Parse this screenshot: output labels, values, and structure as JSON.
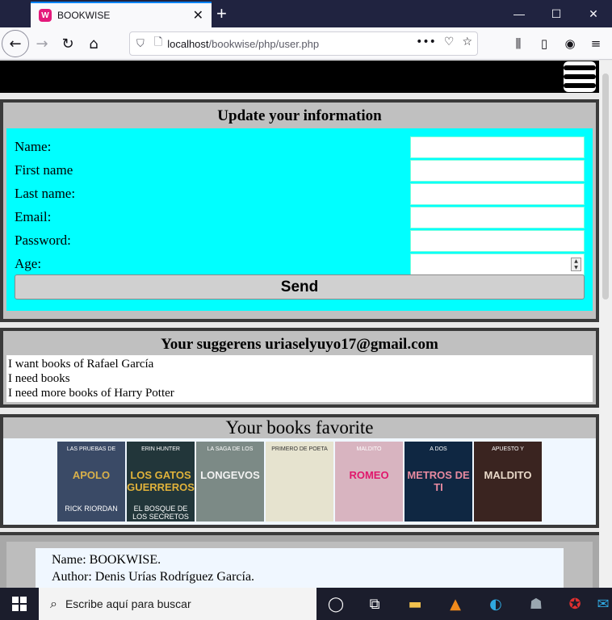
{
  "browser": {
    "tab_title": "BOOKWISE",
    "tab_favicon": "W",
    "url_host": "localhost",
    "url_path": "/bookwise/php/user.php"
  },
  "update_form": {
    "title": "Update your information",
    "fields": [
      {
        "label": "Name:",
        "value": ""
      },
      {
        "label": "First name",
        "value": ""
      },
      {
        "label": "Last name:",
        "value": ""
      },
      {
        "label": "Email:",
        "value": ""
      },
      {
        "label": "Password:",
        "value": ""
      },
      {
        "label": "Age:",
        "value": ""
      }
    ],
    "send_label": "Send"
  },
  "suggestions": {
    "title": "Your suggerens uriaselyuyo17@gmail.com",
    "items": [
      "I want books of Rafael García",
      "I need books",
      "I need more books of Harry Potter"
    ]
  },
  "favorites": {
    "title": "Your books favorite",
    "books": [
      {
        "line1": "LAS PRUEBAS DE",
        "line2": "APOLO",
        "line3": "RICK RIORDAN",
        "bg": "#3a4a66",
        "accent": "#d8b04a"
      },
      {
        "line1": "ERIN HUNTER",
        "line2": "LOS GATOS GUERREROS",
        "line3": "EL BOSQUE DE LOS SECRETOS",
        "bg": "#22363a",
        "accent": "#e0b23a"
      },
      {
        "line1": "LA SAGA DE LOS",
        "line2": "LONGEVOS",
        "line3": "",
        "bg": "#7c8a86",
        "accent": "#f2f2f2"
      },
      {
        "line1": "PRIMERO DE POETA",
        "line2": "",
        "line3": "",
        "bg": "#e6e3cf",
        "accent": "#5a6b4a"
      },
      {
        "line1": "MALDITO",
        "line2": "ROMEO",
        "line3": "",
        "bg": "#d8b4c0",
        "accent": "#e0186c"
      },
      {
        "line1": "A DOS",
        "line2": "METROS DE TI",
        "line3": "",
        "bg": "#0f2742",
        "accent": "#e88aa0"
      },
      {
        "line1": "APUESTO Y",
        "line2": "MALDITO",
        "line3": "",
        "bg": "#3a2420",
        "accent": "#e8d8c8"
      }
    ]
  },
  "detail": {
    "name_line": "Name: BOOKWISE.",
    "author_line": "Author: Denis Urías Rodríguez García."
  },
  "taskbar": {
    "search_placeholder": "Escribe aquí para buscar"
  }
}
